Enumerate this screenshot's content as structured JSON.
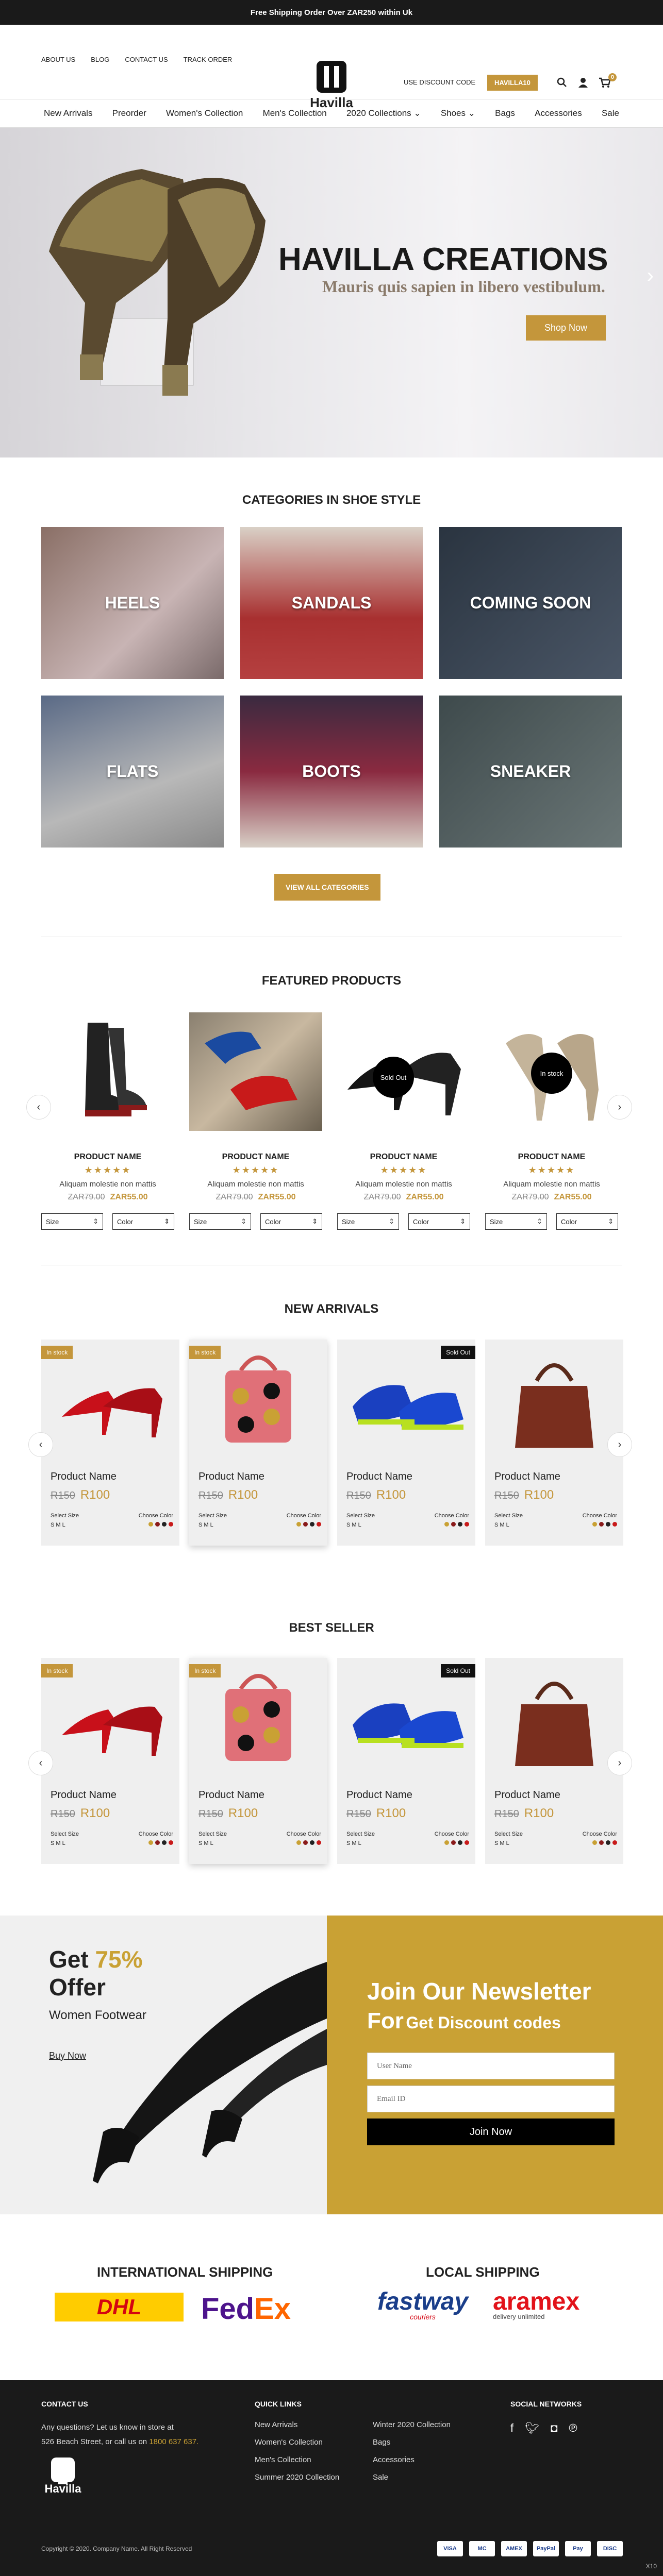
{
  "topbar": {
    "text": "Free Shipping Order Over ZAR250 within Uk"
  },
  "header": {
    "links": [
      "About Us",
      "Blog",
      "Contact Us",
      "Track Order"
    ],
    "logo": "Havilla",
    "discount_label": "Use Discount Code",
    "discount_code": "HAVILLA10",
    "cart_count": "0"
  },
  "nav": [
    "New Arrivals",
    "Preorder",
    "Women's Collection",
    "Men's Collection",
    "2020 Collections ⌄",
    "Shoes ⌄",
    "Bags",
    "Accessories",
    "Sale"
  ],
  "hero": {
    "title": "HAVILLA CREATIONS",
    "subtitle": "Mauris quis sapien in libero vestibulum.",
    "button": "Shop Now"
  },
  "categories": {
    "title": "Categories In Shoe Style",
    "items": [
      "Heels",
      "Sandals",
      "Coming Soon",
      "Flats",
      "Boots",
      "Sneaker"
    ],
    "button": "View All Categories"
  },
  "featured": {
    "title": "Featured Products",
    "items": [
      {
        "name": "Product Name",
        "desc": "Aliquam molestie non mattis",
        "old": "ZAR79.00",
        "new": "ZAR55.00",
        "overlay": ""
      },
      {
        "name": "Product Name",
        "desc": "Aliquam molestie non mattis",
        "old": "ZAR79.00",
        "new": "ZAR55.00",
        "overlay": ""
      },
      {
        "name": "Product Name",
        "desc": "Aliquam molestie non mattis",
        "old": "ZAR79.00",
        "new": "ZAR55.00",
        "overlay": "Sold Out"
      },
      {
        "name": "Product Name",
        "desc": "Aliquam molestie non mattis",
        "old": "ZAR79.00",
        "new": "ZAR55.00",
        "overlay": "In stock"
      }
    ],
    "stars": "★★★★★",
    "size_label": "Size",
    "color_label": "Color"
  },
  "new_arrivals": {
    "title": "New Arrivals",
    "items": [
      {
        "tag": "In stock",
        "tag_type": "in",
        "name": "Product Name",
        "old": "R150",
        "new": "R100"
      },
      {
        "tag": "In stock",
        "tag_type": "in",
        "name": "Product Name",
        "old": "R150",
        "new": "R100"
      },
      {
        "tag": "Sold Out",
        "tag_type": "out",
        "name": "Product Name",
        "old": "R150",
        "new": "R100"
      },
      {
        "tag": "",
        "tag_type": "",
        "name": "Product Name",
        "old": "R150",
        "new": "R100"
      }
    ]
  },
  "best_seller": {
    "title": "Best Seller",
    "items": [
      {
        "tag": "In stock",
        "tag_type": "in",
        "name": "Product Name",
        "old": "R150",
        "new": "R100"
      },
      {
        "tag": "In stock",
        "tag_type": "in",
        "name": "Product Name",
        "old": "R150",
        "new": "R100"
      },
      {
        "tag": "Sold Out",
        "tag_type": "out",
        "name": "Product Name",
        "old": "R150",
        "new": "R100"
      },
      {
        "tag": "",
        "tag_type": "",
        "name": "Product Name",
        "old": "R150",
        "new": "R100"
      }
    ]
  },
  "card_labels": {
    "select_size": "Select Size",
    "sizes": "S  M  L",
    "choose_color": "Choose Color"
  },
  "promo": {
    "get": "Get",
    "pct": "75%",
    "offer": "Offer",
    "sub": "Women Footwear",
    "buy": "Buy Now",
    "nl_title": "Join Our Newsletter",
    "nl_for": "For",
    "nl_sub": "Get Discount codes",
    "user_placeholder": "User Name",
    "email_placeholder": "Email ID",
    "join": "Join Now"
  },
  "shipping": {
    "intl": "International Shipping",
    "local": "Local Shipping",
    "dhl": "DHL",
    "fedex_a": "Fed",
    "fedex_b": "Ex",
    "fastway": "fastway",
    "fastway_sub": "couriers",
    "aramex": "aramex",
    "aramex_sub": "delivery unlimited"
  },
  "footer": {
    "contact_title": "Contact Us",
    "contact_line1": "Any questions? Let us know in store at",
    "contact_line2": "526 Beach Street, or call us on",
    "phone": "1800 637 637.",
    "logo": "Havilla",
    "quick_title": "Quick Links",
    "quick1": [
      "New Arrivals",
      "Women's Collection",
      "Men's Collection",
      "Summer 2020 Collection"
    ],
    "quick2": [
      "Winter 2020 Collection",
      "Bags",
      "Accessories",
      "Sale"
    ],
    "social_title": "Social Networks",
    "copyright": "Copyright © 2020. Company Name. All Right Reserved",
    "payments": [
      "VISA",
      "MC",
      "AMEX",
      "PayPal",
      "Pay",
      "DISC"
    ],
    "corner": "X10"
  }
}
